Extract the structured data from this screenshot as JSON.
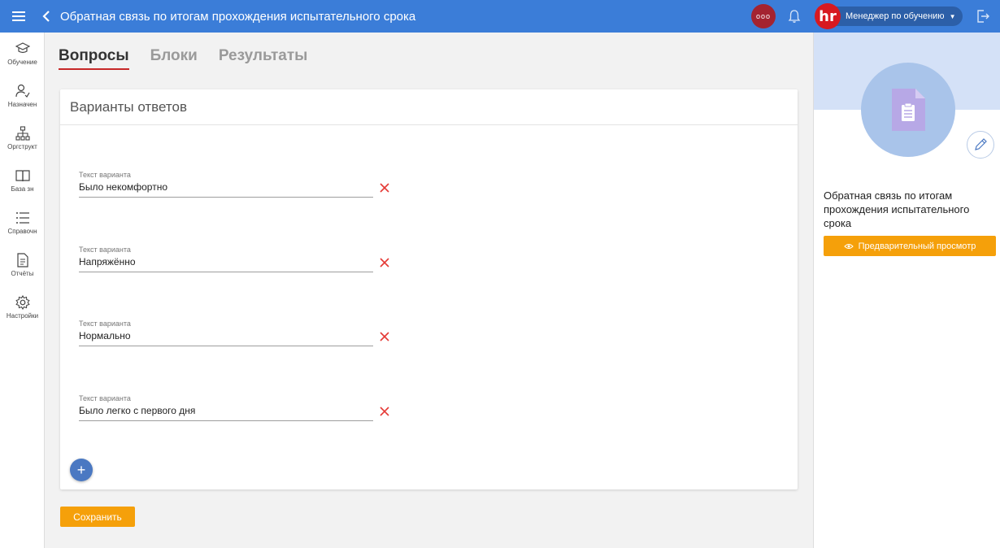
{
  "header": {
    "title": "Обратная связь по итогам прохождения испытательного срока",
    "dots_label": "ooo",
    "user_logo": "hr",
    "user_name": "Менеджер по обучению",
    "caret": "▼"
  },
  "sidebar": {
    "items": [
      {
        "label": "Обучение",
        "icon": "graduation-cap-icon"
      },
      {
        "label": "Назначен",
        "icon": "user-check-icon"
      },
      {
        "label": "Оргструкт",
        "icon": "org-structure-icon"
      },
      {
        "label": "База зн",
        "icon": "book-icon"
      },
      {
        "label": "Справочн",
        "icon": "list-icon"
      },
      {
        "label": "Отчёты",
        "icon": "document-icon"
      },
      {
        "label": "Настройки",
        "icon": "gear-icon"
      }
    ]
  },
  "tabs": [
    {
      "label": "Вопросы",
      "active": true
    },
    {
      "label": "Блоки",
      "active": false
    },
    {
      "label": "Результаты",
      "active": false
    }
  ],
  "card": {
    "title": "Варианты ответов",
    "options": [
      {
        "label": "Текст варианта",
        "value": "Было некомфортно"
      },
      {
        "label": "Текст варианта",
        "value": "Напряжённо"
      },
      {
        "label": "Текст варианта",
        "value": "Нормально"
      },
      {
        "label": "Текст варианта",
        "value": "Было легко с первого дня"
      }
    ],
    "add_label": "+"
  },
  "save_label": "Сохранить",
  "right_panel": {
    "title": "Обратная связь по итогам прохождения испытательного срока",
    "preview_label": "Предварительный просмотр"
  },
  "colors": {
    "topbar": "#3b7dd8",
    "accent_orange": "#f5a00a",
    "delete_red": "#e53935",
    "tab_underline": "#c62828"
  }
}
